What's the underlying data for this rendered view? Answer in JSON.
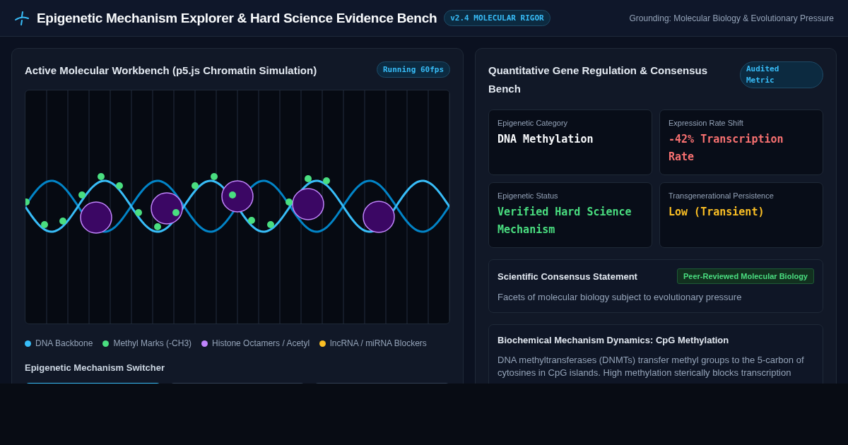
{
  "header": {
    "title": "Epigenetic Mechanism Explorer & Hard Science Evidence Bench",
    "version_badge": "v2.4 MOLECULAR RIGOR",
    "grounding": "Grounding: Molecular Biology & Evolutionary Pressure"
  },
  "workbench": {
    "title": "Active Molecular Workbench (p5.js Chromatin Simulation)",
    "status_badge": "Running 60fps",
    "legend": [
      {
        "label": "DNA Backbone",
        "color": "#38bdf8"
      },
      {
        "label": "Methyl Marks (-CH3)",
        "color": "#4ade80"
      },
      {
        "label": "Histone Octamers / Acetyl",
        "color": "#c084fc"
      },
      {
        "label": "lncRNA / miRNA Blockers",
        "color": "#fbbf24"
      }
    ],
    "switcher": {
      "title": "Epigenetic Mechanism Switcher",
      "options": [
        {
          "selected": true
        },
        {
          "selected": false
        },
        {
          "selected": false
        }
      ]
    }
  },
  "regulation": {
    "title": "Quantitative Gene Regulation & Consensus Bench",
    "badge": "Audited Metric",
    "metrics": [
      {
        "label": "Epigenetic Category",
        "value": "DNA Methylation",
        "color": "#f8fafc"
      },
      {
        "label": "Expression Rate Shift",
        "value": "-42% Transcription Rate",
        "color": "#f87171"
      },
      {
        "label": "Epigenetic Status",
        "value": "Verified Hard Science Mechanism",
        "color": "#4ade80"
      },
      {
        "label": "Transgenerational Persistence",
        "value": "Low (Transient)",
        "color": "#fbbf24"
      }
    ],
    "consensus": {
      "title": "Scientific Consensus Statement",
      "badge": "Peer-Reviewed Molecular Biology",
      "text": "Facets of molecular biology subject to evolutionary pressure"
    },
    "dynamics": {
      "title": "Biochemical Mechanism Dynamics: CpG Methylation",
      "text": "DNA methyltransferases (DNMTs) transfer methyl groups to the 5-carbon of cytosines in CpG islands. High methylation sterically blocks transcription"
    }
  }
}
